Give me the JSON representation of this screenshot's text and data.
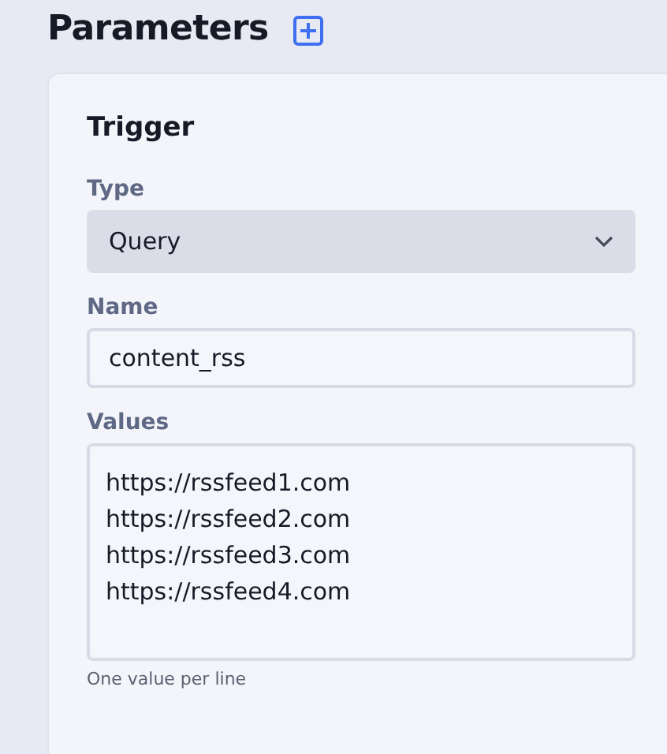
{
  "page": {
    "title": "Parameters"
  },
  "card": {
    "title": "Trigger",
    "fields": [
      {
        "kind": "select",
        "label": "Type",
        "value": "Query"
      },
      {
        "kind": "input",
        "label": "Name",
        "value": "content_rss"
      },
      {
        "kind": "textarea",
        "label": "Values",
        "lines": [
          "https://rssfeed1.com",
          "https://rssfeed2.com",
          "https://rssfeed3.com",
          "https://rssfeed4.com"
        ],
        "hint": "One value per line"
      }
    ]
  }
}
